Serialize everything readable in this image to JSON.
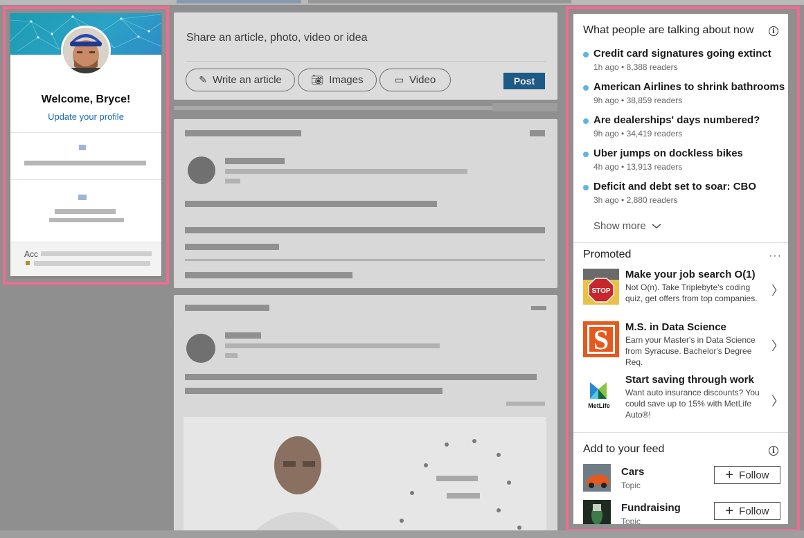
{
  "profile": {
    "welcome": "Welcome, Bryce!",
    "update_link": "Update your profile",
    "access_label": "Acc"
  },
  "share": {
    "placeholder": "Share an article, photo, video or idea",
    "write_article": "Write an article",
    "images": "Images",
    "video": "Video",
    "post": "Post"
  },
  "news": {
    "heading": "What people are talking about now",
    "items": [
      {
        "title": "Credit card signatures going extinct",
        "meta": "1h ago • 8,388 readers"
      },
      {
        "title": "American Airlines to shrink bathrooms",
        "meta": "9h ago • 38,859 readers"
      },
      {
        "title": "Are dealerships' days numbered?",
        "meta": "9h ago • 34,419 readers"
      },
      {
        "title": "Uber jumps on dockless bikes",
        "meta": "4h ago • 13,913 readers"
      },
      {
        "title": "Deficit and debt set to soar: CBO",
        "meta": "3h ago • 2,880 readers"
      }
    ],
    "show_more": "Show more"
  },
  "promoted": {
    "heading": "Promoted",
    "more": "···",
    "items": [
      {
        "title": "Make your job search O(1)",
        "desc": "Not O(n). Take Triplebyte's coding quiz, get offers from top companies.",
        "logo_icon": "stop-sign-icon"
      },
      {
        "title": "M.S. in Data Science",
        "desc": "Earn your Master's in Data Science from Syracuse. Bachelor's Degree Req.",
        "logo_icon": "syracuse-s-icon",
        "logo_text": "S"
      },
      {
        "title": "Start saving through work",
        "desc": "Want auto insurance discounts? You could save up to 15% with MetLife Auto®!",
        "logo_icon": "metlife-icon",
        "logo_text": "MetLife"
      }
    ]
  },
  "feed_suggest": {
    "heading": "Add to your feed",
    "topics": [
      {
        "name": "Cars",
        "type": "Topic",
        "follow": "Follow"
      },
      {
        "name": "Fundraising",
        "type": "Topic",
        "follow": "Follow"
      }
    ]
  },
  "colors": {
    "highlight": "#f06b93",
    "link": "#1a6ab5",
    "bullet": "#5fb4e0",
    "post_button": "#1d5a86",
    "syracuse_orange": "#e5591e"
  }
}
